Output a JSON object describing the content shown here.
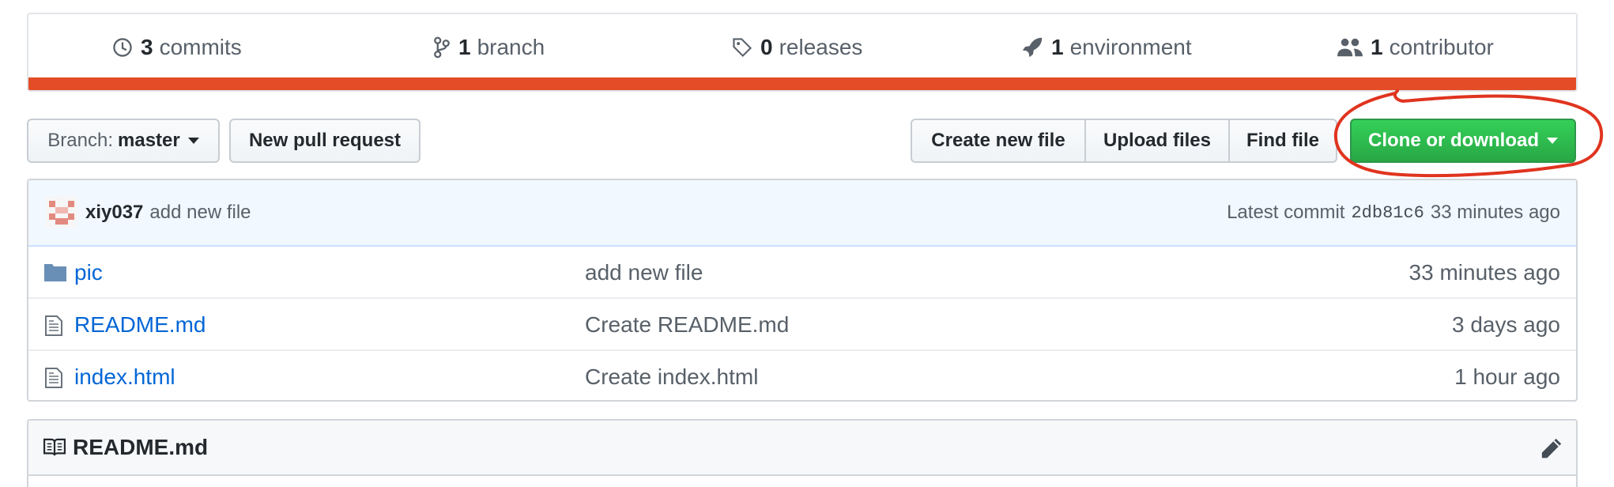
{
  "stats": [
    {
      "icon": "history-icon",
      "count": "3",
      "label": "commits"
    },
    {
      "icon": "git-branch-icon",
      "count": "1",
      "label": "branch"
    },
    {
      "icon": "tag-icon",
      "count": "0",
      "label": "releases"
    },
    {
      "icon": "rocket-icon",
      "count": "1",
      "label": "environment"
    },
    {
      "icon": "people-icon",
      "count": "1",
      "label": "contributor"
    }
  ],
  "language_bar_color": "#e34c26",
  "toolbar": {
    "branch_prefix": "Branch:",
    "branch_name": "master",
    "new_pr_label": "New pull request",
    "create_file_label": "Create new file",
    "upload_files_label": "Upload files",
    "find_file_label": "Find file",
    "clone_label": "Clone or download",
    "clone_color": "#28a745"
  },
  "commit": {
    "author": "xiy037",
    "message": "add new file",
    "latest_prefix": "Latest commit",
    "sha": "2db81c6",
    "age": "33 minutes ago"
  },
  "files": [
    {
      "type": "folder",
      "icon": "folder-icon",
      "name": "pic",
      "message": "add new file",
      "age": "33 minutes ago"
    },
    {
      "type": "file",
      "icon": "file-icon",
      "name": "README.md",
      "message": "Create README.md",
      "age": "3 days ago"
    },
    {
      "type": "file",
      "icon": "file-icon",
      "name": "index.html",
      "message": "Create index.html",
      "age": "1 hour ago"
    }
  ],
  "readme": {
    "title": "README.md",
    "icon": "book-icon",
    "edit_icon": "pencil-icon"
  },
  "annotation": {
    "color": "#e0341f",
    "target": "clone-or-download-button"
  }
}
